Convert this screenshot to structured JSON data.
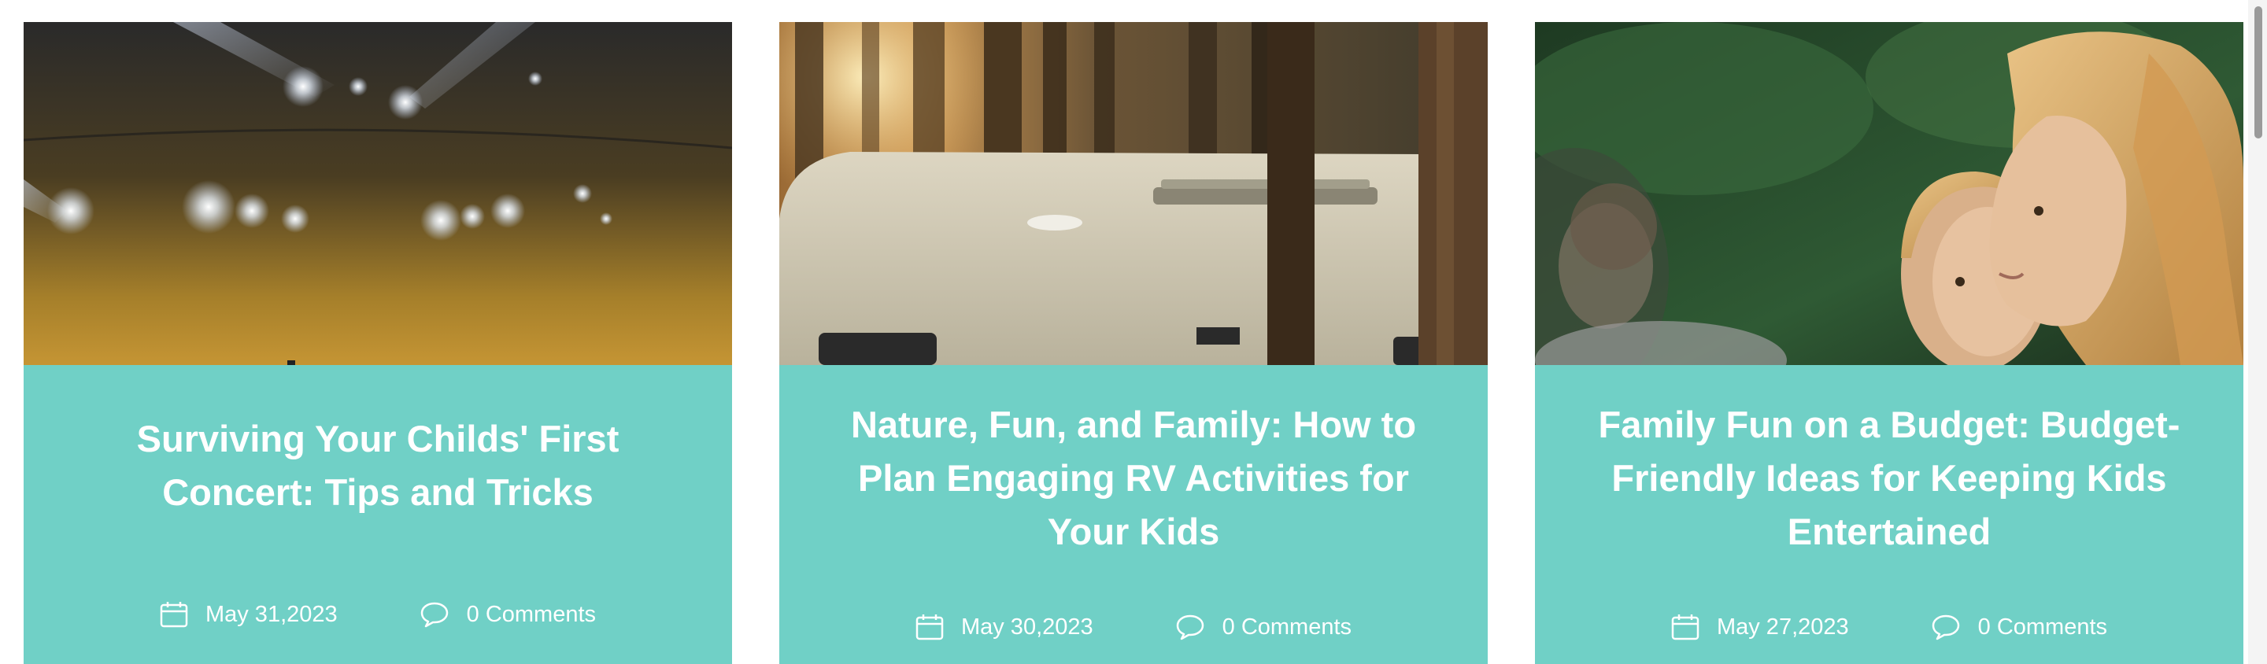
{
  "theme": {
    "card_color": "#70d0c6",
    "text_color": "#ffffff"
  },
  "cards": [
    {
      "title": "Surviving Your Childs' First Concert: Tips and Tricks",
      "date": "May 31,2023",
      "comments": "0 Comments",
      "image_icon": "concert-photo"
    },
    {
      "title": "Nature, Fun, and Family: How to Plan Engaging RV Activities for Your Kids",
      "date": "May 30,2023",
      "comments": "0 Comments",
      "image_icon": "rv-forest-photo"
    },
    {
      "title": "Family Fun on a Budget: Budget-Friendly Ideas for Keeping Kids Entertained",
      "date": "May 27,2023",
      "comments": "0 Comments",
      "image_icon": "family-photo"
    }
  ]
}
